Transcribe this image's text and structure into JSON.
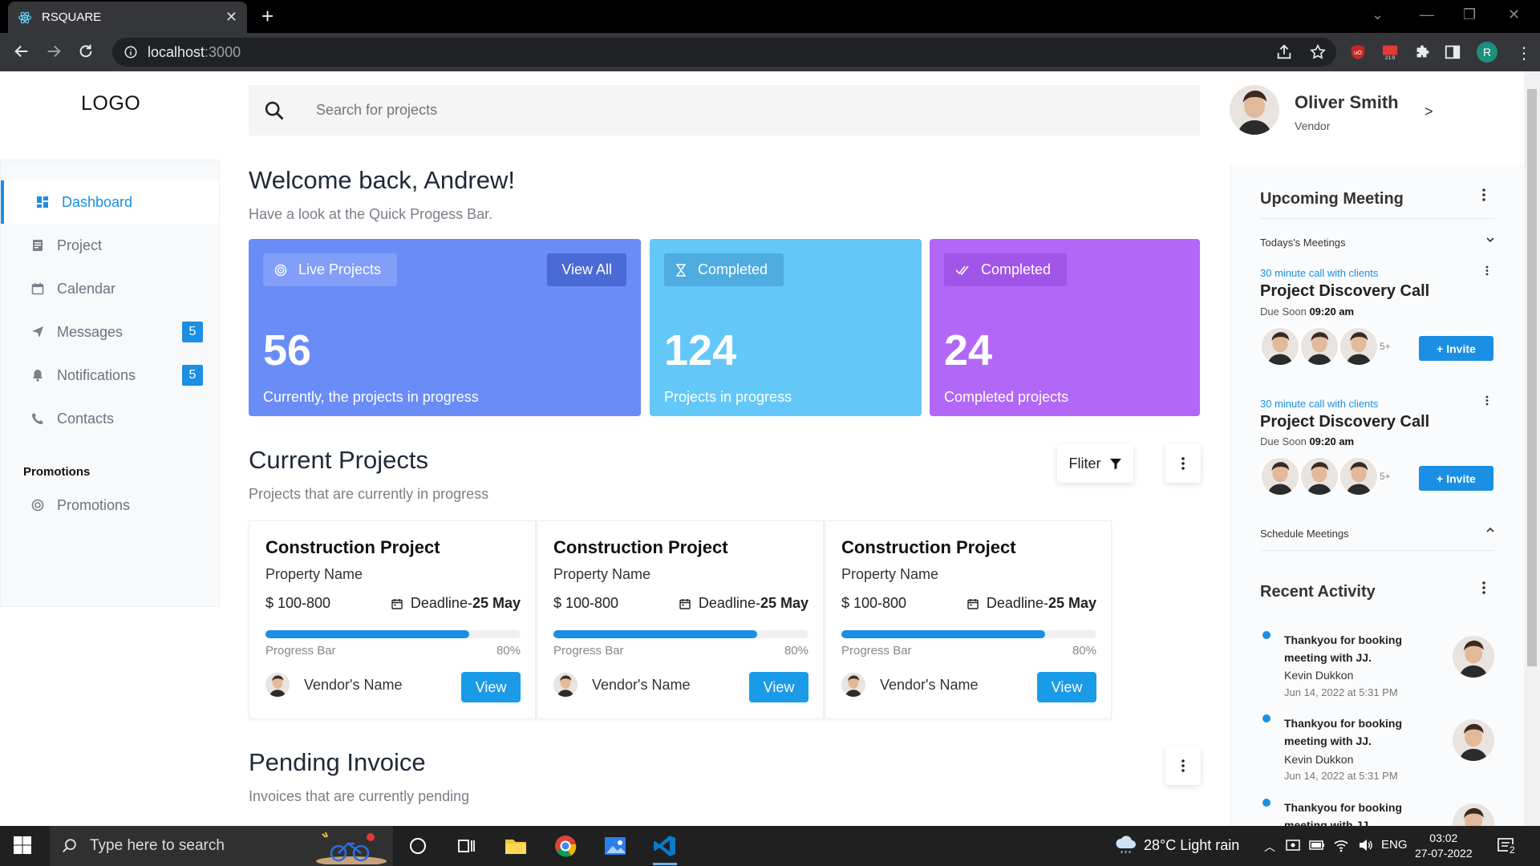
{
  "browser": {
    "tab_title": "RSQUARE",
    "tab_close": "✕",
    "new_tab": "+",
    "url_host": "localhost",
    "url_port": ":3000"
  },
  "logo": "LOGO",
  "search": {
    "placeholder": "Search for projects"
  },
  "sidebar": {
    "items": [
      {
        "label": "Dashboard",
        "icon": "dashboard-icon",
        "active": true
      },
      {
        "label": "Project",
        "icon": "project-icon"
      },
      {
        "label": "Calendar",
        "icon": "calendar-icon"
      },
      {
        "label": "Messages",
        "icon": "send-icon",
        "badge": "5"
      },
      {
        "label": "Notifications",
        "icon": "bell-icon",
        "badge": "5"
      },
      {
        "label": "Contacts",
        "icon": "phone-icon"
      }
    ],
    "promotions_heading": "Promotions",
    "promotions_item": "Promotions"
  },
  "welcome": {
    "title": "Welcome back, Andrew!",
    "subtitle": "Have a look at the Quick Progess Bar."
  },
  "stats": [
    {
      "pill": "Live Projects",
      "number": "56",
      "desc": "Currently, the projects in progress",
      "color": "#6a8cf7",
      "action": "View All"
    },
    {
      "pill": "Completed",
      "number": "124",
      "desc": "Projects in progress",
      "color": "#63c8f7"
    },
    {
      "pill": "Completed",
      "number": "24",
      "desc": "Completed projects",
      "color": "#b367f7"
    }
  ],
  "current_projects": {
    "title": "Current Projects",
    "subtitle": "Projects that are currently in progress",
    "filter_label": "Fliter",
    "cards": [
      {
        "title": "Construction Project",
        "property": "Property Name",
        "price": "$ 100-800",
        "deadline_label": "Deadline-",
        "deadline_date": "25 May",
        "progress_label": "Progress Bar",
        "progress_pct": "80%",
        "progress": 0.8,
        "vendor": "Vendor's Name",
        "button": "View"
      },
      {
        "title": "Construction Project",
        "property": "Property Name",
        "price": "$ 100-800",
        "deadline_label": "Deadline-",
        "deadline_date": "25 May",
        "progress_label": "Progress Bar",
        "progress_pct": "80%",
        "progress": 0.8,
        "vendor": "Vendor's Name",
        "button": "View"
      },
      {
        "title": "Construction Project",
        "property": "Property Name",
        "price": "$ 100-800",
        "deadline_label": "Deadline-",
        "deadline_date": "25 May",
        "progress_label": "Progress Bar",
        "progress_pct": "80%",
        "progress": 0.8,
        "vendor": "Vendor's Name",
        "button": "View"
      }
    ]
  },
  "pending_invoice": {
    "title": "Pending Invoice",
    "subtitle": "Invoices that are currently pending"
  },
  "profile": {
    "name": "Oliver Smith",
    "role": "Vendor",
    "arrow": ">"
  },
  "upcoming": {
    "title": "Upcoming Meeting",
    "todays": "Todays's Meetings",
    "meetings": [
      {
        "link": "30 minute call with clients",
        "title": "Project Discovery Call",
        "due_label": "Due Soon",
        "due_time": "09:20 am",
        "more": "5+",
        "invite": "+ Invite"
      },
      {
        "link": "30 minute call with clients",
        "title": "Project Discovery Call",
        "due_label": "Due Soon",
        "due_time": "09:20 am",
        "more": "5+",
        "invite": "+ Invite"
      }
    ],
    "schedule": "Schedule Meetings"
  },
  "recent": {
    "title": "Recent Activity",
    "items": [
      {
        "text": "Thankyou for booking meeting with JJ.",
        "name": "Kevin Dukkon",
        "time": "Jun 14, 2022 at 5:31 PM"
      },
      {
        "text": "Thankyou for booking meeting with JJ.",
        "name": "Kevin Dukkon",
        "time": "Jun 14, 2022 at 5:31 PM"
      },
      {
        "text": "Thankyou for booking meeting with JJ.",
        "name": "",
        "time": ""
      }
    ]
  },
  "taskbar": {
    "search_placeholder": "Type here to search",
    "weather": "28°C  Light rain",
    "lang": "ENG",
    "time": "03:02",
    "date": "27-07-2022",
    "notif_count": "2"
  }
}
